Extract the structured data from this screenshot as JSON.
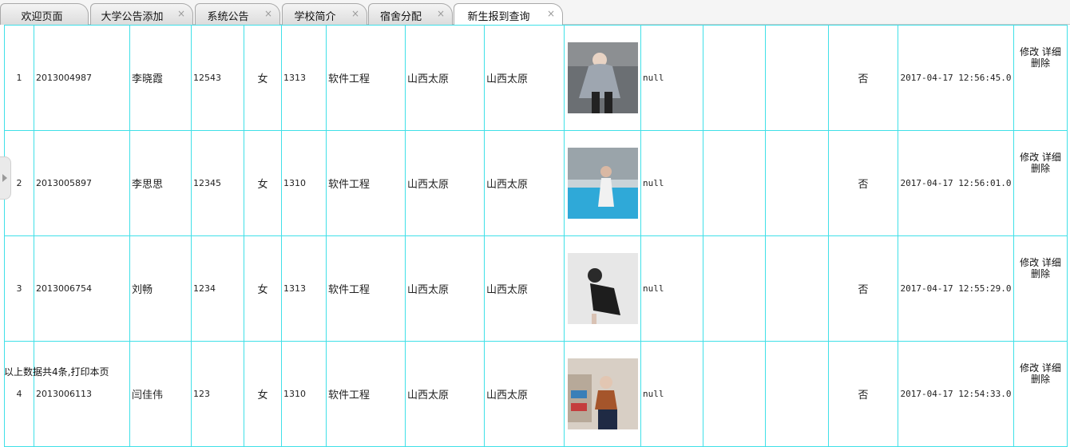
{
  "tabs": [
    {
      "label": "欢迎页面",
      "closable": false
    },
    {
      "label": "大学公告添加",
      "closable": true
    },
    {
      "label": "系统公告",
      "closable": true
    },
    {
      "label": "学校简介",
      "closable": true
    },
    {
      "label": "宿舍分配",
      "closable": true
    },
    {
      "label": "新生报到查询",
      "closable": true,
      "active": true
    }
  ],
  "close_glyph": "×",
  "actions": {
    "edit": "修改",
    "detail": "详细",
    "delete": "删除"
  },
  "rows": [
    {
      "index": "1",
      "student_id": "2013004987",
      "name": "李晓霞",
      "num": "12543",
      "gender": "女",
      "class": "1313",
      "major": "软件工程",
      "origin": "山西太原",
      "address": "山西太原",
      "photo": "student-photo-1",
      "remark": "null",
      "col12": "",
      "col13": "",
      "status": "否",
      "time": "2017-04-17 12:56:45.0"
    },
    {
      "index": "2",
      "student_id": "2013005897",
      "name": "李思思",
      "num": "12345",
      "gender": "女",
      "class": "1310",
      "major": "软件工程",
      "origin": "山西太原",
      "address": "山西太原",
      "photo": "student-photo-2",
      "remark": "null",
      "col12": "",
      "col13": "",
      "status": "否",
      "time": "2017-04-17 12:56:01.0"
    },
    {
      "index": "3",
      "student_id": "2013006754",
      "name": "刘畅",
      "num": "1234",
      "gender": "女",
      "class": "1313",
      "major": "软件工程",
      "origin": "山西太原",
      "address": "山西太原",
      "photo": "student-photo-3",
      "remark": "null",
      "col12": "",
      "col13": "",
      "status": "否",
      "time": "2017-04-17 12:55:29.0"
    },
    {
      "index": "4",
      "student_id": "2013006113",
      "name": "闫佳伟",
      "num": "123",
      "gender": "女",
      "class": "1310",
      "major": "软件工程",
      "origin": "山西太原",
      "address": "山西太原",
      "photo": "student-photo-4",
      "remark": "null",
      "col12": "",
      "col13": "",
      "status": "否",
      "time": "2017-04-17 12:54:33.0"
    }
  ],
  "footer": {
    "text": "以上数据共4条,",
    "print_link": "打印本页"
  },
  "colors": {
    "grid_border": "#40e0e8",
    "tab_border": "#a9a9a9"
  }
}
